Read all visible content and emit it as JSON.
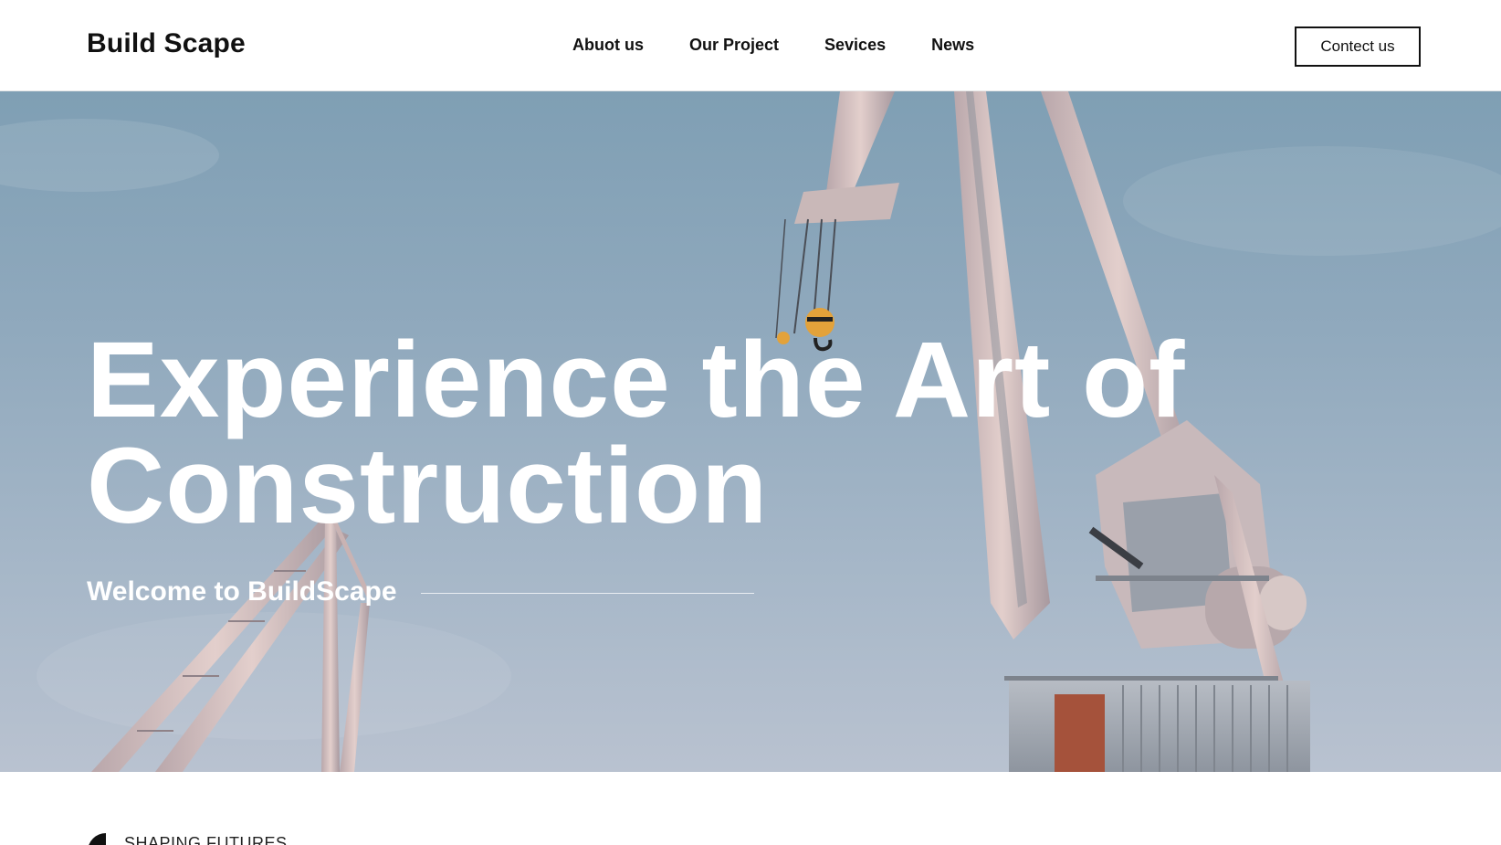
{
  "header": {
    "brand": "Build Scape",
    "nav": [
      {
        "label": "Abuot us"
      },
      {
        "label": "Our Project"
      },
      {
        "label": "Sevices"
      },
      {
        "label": "News"
      }
    ],
    "contact_label": "Contect us"
  },
  "hero": {
    "title_line1": "Experience the Art of",
    "title_line2": "Construction",
    "subtitle": "Welcome to BuildScape"
  },
  "section": {
    "label": "SHAPING FUTURES",
    "icon": "quarter-circle-icon"
  },
  "colors": {
    "text": "#111111",
    "hero_text": "#ffffff",
    "sky": "#8fa8bc",
    "crane": "#d9c4c2"
  }
}
